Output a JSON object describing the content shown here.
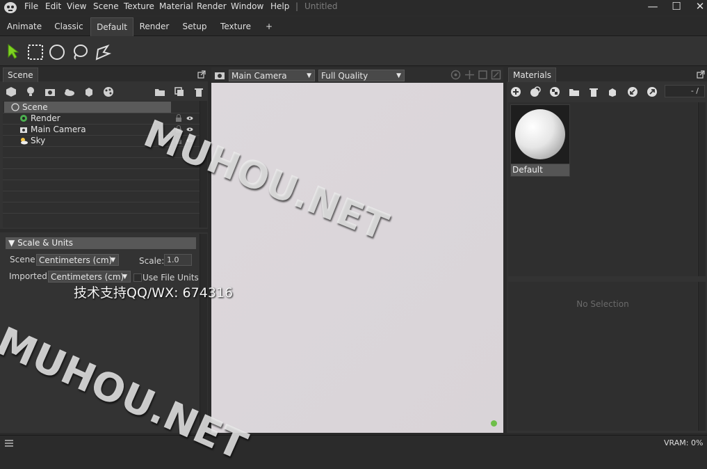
{
  "menubar": {
    "items": [
      "File",
      "Edit",
      "View",
      "Scene",
      "Texture",
      "Material",
      "Render",
      "Window",
      "Help"
    ],
    "separator": "|",
    "doc_title": "Untitled",
    "minimize": "—",
    "maximize": "☐",
    "close": "✕"
  },
  "tabs": [
    "Animate",
    "Classic",
    "Default",
    "Render",
    "Setup",
    "Texture",
    "+"
  ],
  "active_tab": "Default",
  "scene_panel": {
    "tab_label": "Scene",
    "tree": [
      {
        "label": "Scene",
        "icon": "scene-icon"
      },
      {
        "label": "Render",
        "icon": "render-gear-icon"
      },
      {
        "label": "Main Camera",
        "icon": "camera-icon"
      },
      {
        "label": "Sky",
        "icon": "sky-icon"
      }
    ]
  },
  "scale_panel": {
    "title": "Scale & Units",
    "scene_label": "Scene",
    "scene_value": "Centimeters (cm)",
    "scale_label": "Scale:",
    "scale_value": "1.0",
    "imported_label": "Imported",
    "imported_value": "Centimeters (cm)",
    "use_file_units_label": "Use File Units"
  },
  "viewport": {
    "camera_select": "Main Camera",
    "quality_select": "Full Quality"
  },
  "materials_panel": {
    "tab_label": "Materials",
    "counter": "- /",
    "material_name": "Default",
    "no_selection": "No Selection"
  },
  "statusbar": {
    "vram": "VRAM: 0%"
  },
  "watermarks": {
    "top": "MUHOU.NET",
    "bottom": "MUHOU.NET",
    "support": "技术支持QQ/WX: 674316"
  },
  "colors": {
    "select_tool_green": "#7ed321",
    "status_dot": "#6fbf4a"
  }
}
